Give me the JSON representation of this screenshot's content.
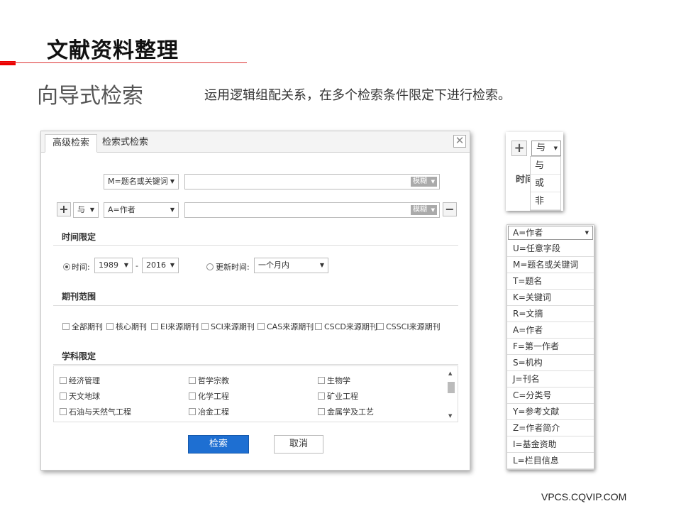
{
  "slide": {
    "title": "文献资料整理",
    "subtitle": "向导式检索",
    "description": "运用逻辑组配关系，在多个检索条件限定下进行检索。",
    "footer_url": "VPCS.CQVIP.COM",
    "accent_color": "#e00000"
  },
  "dialog": {
    "tabs": [
      "高级检索",
      "检索式检索"
    ],
    "close": "✕",
    "row1": {
      "field": "M=题名或关键词",
      "match": "模糊"
    },
    "row2": {
      "logic": "与",
      "field": "A=作者",
      "match": "模糊"
    },
    "time_section": {
      "label": "时间限定",
      "time_label": "时间:",
      "from_year": "1989",
      "dash": "-",
      "to_year": "2016",
      "update_label": "更新时间:",
      "update_value": "一个月内"
    },
    "journal_section": {
      "label": "期刊范围",
      "options": [
        "全部期刊",
        "核心期刊",
        "EI来源期刊",
        "SCI来源期刊",
        "CAS来源期刊",
        "CSCD来源期刊",
        "CSSCI来源期刊"
      ]
    },
    "subject_section": {
      "label": "学科限定",
      "options": [
        "经济管理",
        "哲学宗教",
        "生物学",
        "天文地球",
        "化学工程",
        "矿业工程",
        "石油与天然气工程",
        "冶金工程",
        "金属学及工艺"
      ]
    },
    "search_button": "检索",
    "cancel_button": "取消",
    "primary_color": "#1e6fd2"
  },
  "logic_dropdown": {
    "selected": "与",
    "background_text": "时间",
    "options": [
      "与",
      "或",
      "非"
    ]
  },
  "field_dropdown": {
    "selected": "A=作者",
    "options": [
      "U=任意字段",
      "M=题名或关键词",
      "T=题名",
      "K=关键词",
      "R=文摘",
      "A=作者",
      "F=第一作者",
      "S=机构",
      "J=刊名",
      "C=分类号",
      "Y=参考文献",
      "Z=作者简介",
      "I=基金资助",
      "L=栏目信息"
    ]
  }
}
